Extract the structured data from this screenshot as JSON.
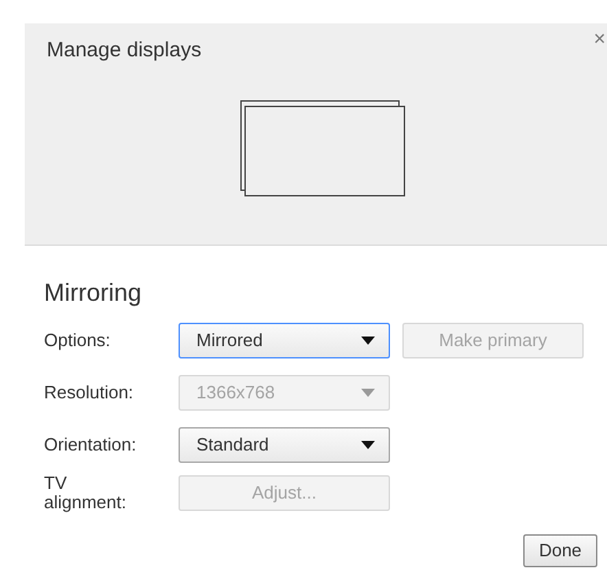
{
  "window": {
    "title": "Manage displays",
    "close": "×"
  },
  "section": {
    "title": "Mirroring"
  },
  "rows": [
    {
      "label": "Options:",
      "kind": "select",
      "value": "Mirrored",
      "disabled": false,
      "focused": true,
      "extra_button": {
        "label": "Make primary",
        "disabled": true
      }
    },
    {
      "label": "Resolution:",
      "kind": "select",
      "value": "1366x768",
      "disabled": true,
      "focused": false
    },
    {
      "label": "Orientation:",
      "kind": "select",
      "value": "Standard",
      "disabled": false,
      "focused": false
    },
    {
      "label": "TV alignment:",
      "kind": "button",
      "value": "Adjust...",
      "disabled": true,
      "focused": false
    }
  ],
  "buttons": [
    {
      "label": "Done"
    }
  ]
}
